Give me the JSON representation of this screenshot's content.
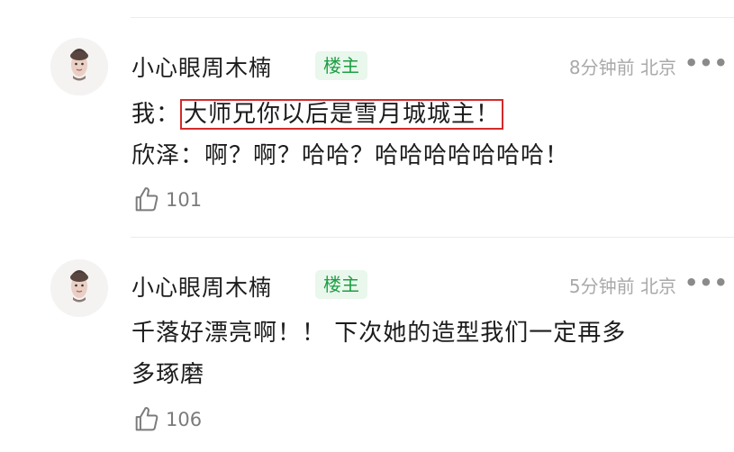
{
  "comments": [
    {
      "username": "小心眼周木楠",
      "badge": "楼主",
      "meta": "8分钟前 北京",
      "more": "•••",
      "line1_prefix": "我：",
      "line1_highlight": "大师兄你以后是雪月城城主！",
      "line2": "欣泽：啊？啊？哈哈？哈哈哈哈哈哈哈！",
      "likes": "101",
      "icons": [
        "avatar",
        "thumbs-up-icon",
        "more-icon"
      ]
    },
    {
      "username": "小心眼周木楠",
      "badge": "楼主",
      "meta": "5分钟前 北京",
      "more": "•••",
      "line1": "千落好漂亮啊！！ 下次她的造型我们一定再多",
      "line2": "多琢磨",
      "likes": "106",
      "icons": [
        "avatar",
        "thumbs-up-icon",
        "more-icon"
      ]
    }
  ]
}
